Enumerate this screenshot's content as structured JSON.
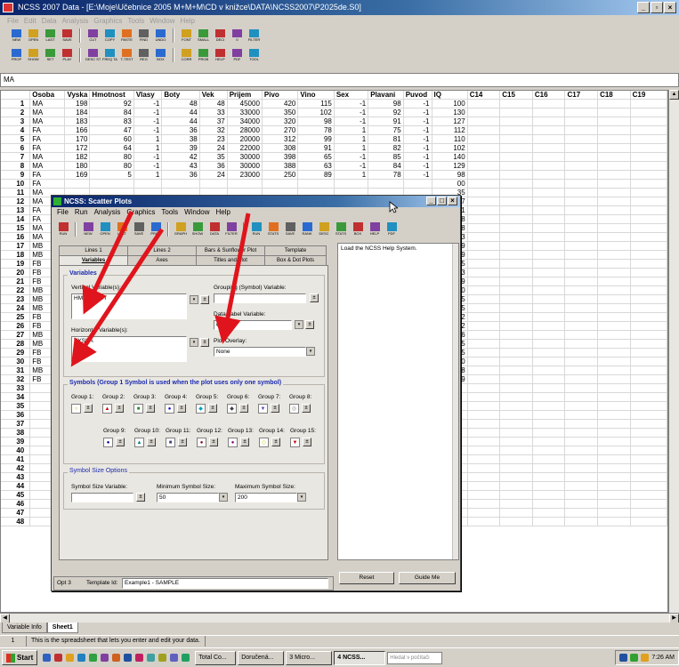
{
  "app": {
    "title": "NCSS 2007 Data - [E:\\Moje\\Učebnice 2005 M+M+M\\CD v knižce\\DATA\\NCSS2007\\P2025de.S0]",
    "menu": [
      "File",
      "Edit",
      "Data",
      "Analysis",
      "Graphics",
      "Tools",
      "Window",
      "Help"
    ],
    "toolbar1": [
      "NEW",
      "OPEN",
      "LAST",
      "SAVE",
      "CUT",
      "COPY",
      "PASTE",
      "FIND",
      "UNDO",
      "FONT",
      "SMALL",
      "DECI",
      "0",
      "FILTER"
    ],
    "toolbar2": [
      "PROP",
      "SHOW",
      "SET",
      "PLAY",
      "DESC STATS",
      "FREQ TABLE",
      "T-TEST",
      "REG",
      "BOX",
      "CORR",
      "PROB",
      "HELP",
      "PDF",
      "TOOL"
    ],
    "cell_ref": "MA"
  },
  "sheet": {
    "columns": [
      "Osoba",
      "Vyska",
      "Hmotnost",
      "Vlasy",
      "Boty",
      "Vek",
      "Prijem",
      "Pivo",
      "Vino",
      "Sex",
      "Plavani",
      "Puvod",
      "IQ",
      "C14",
      "C15",
      "C16",
      "C17",
      "C18",
      "C19"
    ],
    "rows": [
      [
        "MA",
        "198",
        "92",
        "-1",
        "48",
        "48",
        "45000",
        "420",
        "115",
        "-1",
        "98",
        "-1",
        "100"
      ],
      [
        "MA",
        "184",
        "84",
        "-1",
        "44",
        "33",
        "33000",
        "350",
        "102",
        "-1",
        "92",
        "-1",
        "130"
      ],
      [
        "MA",
        "183",
        "83",
        "-1",
        "44",
        "37",
        "34000",
        "320",
        "98",
        "-1",
        "91",
        "-1",
        "127"
      ],
      [
        "FA",
        "166",
        "47",
        "-1",
        "36",
        "32",
        "28000",
        "270",
        "78",
        "1",
        "75",
        "-1",
        "112"
      ],
      [
        "FA",
        "170",
        "60",
        "1",
        "38",
        "23",
        "20000",
        "312",
        "99",
        "1",
        "81",
        "-1",
        "110"
      ],
      [
        "FA",
        "172",
        "64",
        "1",
        "39",
        "24",
        "22000",
        "308",
        "91",
        "1",
        "82",
        "-1",
        "102"
      ],
      [
        "MA",
        "182",
        "80",
        "-1",
        "42",
        "35",
        "30000",
        "398",
        "65",
        "-1",
        "85",
        "-1",
        "140"
      ],
      [
        "MA",
        "180",
        "80",
        "-1",
        "43",
        "36",
        "30000",
        "388",
        "63",
        "-1",
        "84",
        "-1",
        "129"
      ],
      [
        "FA",
        "169",
        "5",
        "1",
        "36",
        "24",
        "23000",
        "250",
        "89",
        "1",
        "78",
        "-1",
        "98"
      ],
      [
        "FA",
        "",
        "",
        "",
        "",
        "",
        "",
        "",
        "",
        "",
        "",
        "",
        "00"
      ],
      [
        "MA",
        "",
        "",
        "",
        "",
        "",
        "",
        "",
        "",
        "",
        "",
        "",
        "35"
      ],
      [
        "MA",
        "",
        "",
        "",
        "",
        "",
        "",
        "",
        "",
        "",
        "",
        "",
        "27"
      ],
      [
        "FA",
        "",
        "",
        "",
        "",
        "",
        "",
        "",
        "",
        "",
        "",
        "",
        "01"
      ],
      [
        "FA",
        "",
        "",
        "",
        "",
        "",
        "",
        "",
        "",
        "",
        "",
        "",
        "38"
      ],
      [
        "MA",
        "",
        "",
        "",
        "",
        "",
        "",
        "",
        "",
        "",
        "",
        "",
        "28"
      ],
      [
        "MA",
        "",
        "",
        "",
        "",
        "",
        "",
        "",
        "",
        "",
        "",
        "",
        "13"
      ],
      [
        "MB",
        "",
        "",
        "",
        "",
        "",
        "",
        "",
        "",
        "",
        "",
        "",
        "39"
      ],
      [
        "MB",
        "",
        "",
        "",
        "",
        "",
        "",
        "",
        "",
        "",
        "",
        "",
        "19"
      ],
      [
        "FB",
        "",
        "",
        "",
        "",
        "",
        "",
        "",
        "",
        "",
        "",
        "",
        "95"
      ],
      [
        "FB",
        "",
        "",
        "",
        "",
        "",
        "",
        "",
        "",
        "",
        "",
        "",
        "23"
      ],
      [
        "FB",
        "",
        "",
        "",
        "",
        "",
        "",
        "",
        "",
        "",
        "",
        "",
        "19"
      ],
      [
        "MB",
        "",
        "",
        "",
        "",
        "",
        "",
        "",
        "",
        "",
        "",
        "",
        "20"
      ],
      [
        "MB",
        "",
        "",
        "",
        "",
        "",
        "",
        "",
        "",
        "",
        "",
        "",
        "15"
      ],
      [
        "MB",
        "",
        "",
        "",
        "",
        "",
        "",
        "",
        "",
        "",
        "",
        "",
        "05"
      ],
      [
        "FB",
        "",
        "",
        "",
        "",
        "",
        "",
        "",
        "",
        "",
        "",
        "",
        "32"
      ],
      [
        "FB",
        "",
        "",
        "",
        "",
        "",
        "",
        "",
        "",
        "",
        "",
        "",
        "02"
      ],
      [
        "MB",
        "",
        "",
        "",
        "",
        "",
        "",
        "",
        "",
        "",
        "",
        "",
        "36"
      ],
      [
        "MB",
        "",
        "",
        "",
        "",
        "",
        "",
        "",
        "",
        "",
        "",
        "",
        "05"
      ],
      [
        "FB",
        "",
        "",
        "",
        "",
        "",
        "",
        "",
        "",
        "",
        "",
        "",
        "25"
      ],
      [
        "FB",
        "",
        "",
        "",
        "",
        "",
        "",
        "",
        "",
        "",
        "",
        "",
        "20"
      ],
      [
        "MB",
        "",
        "",
        "",
        "",
        "",
        "",
        "",
        "",
        "",
        "",
        "",
        "18"
      ],
      [
        "FB",
        "",
        "",
        "",
        "",
        "",
        "",
        "",
        "",
        "",
        "",
        "",
        "29"
      ]
    ],
    "total_rows": 48,
    "tabs": [
      "Variable Info",
      "Sheet1"
    ],
    "status_row": "1",
    "status_text": "This is the spreadsheet that lets you enter and edit your data."
  },
  "dialog": {
    "title": "NCSS: Scatter Plots",
    "menu": [
      "File",
      "Run",
      "Analysis",
      "Graphics",
      "Tools",
      "Window",
      "Help"
    ],
    "toolbar": [
      "RUN",
      "NEW",
      "OPEN",
      "LAST",
      "SAVE",
      "PROP",
      "GRAPH",
      "SHOW",
      "DATA",
      "FILTER",
      "RUN",
      "STATS",
      "SAVE",
      "RANK",
      "DESC",
      "STATS",
      "BOX",
      "HELP",
      "PDF"
    ],
    "tabs_row1": [
      "Lines 1",
      "Lines 2",
      "Bars & Sunflower Plot",
      "Template"
    ],
    "tabs_row2": [
      "Variables",
      "Axes",
      "Titles and Plot",
      "Box & Dot Plots"
    ],
    "variables_group": "Variables",
    "vertical_label": "Vertical Variable(s):",
    "vertical_value": "HMOTNOST",
    "horizontal_label": "Horizontal Variable(s):",
    "horizontal_value": "VYSKA",
    "grouping_label": "Grouping (Symbol) Variable:",
    "grouping_value": "",
    "datalabel_label": "Data Label Variable:",
    "datalabel_value": "Osoba",
    "overlay_label": "Plot Overlay:",
    "overlay_value": "None",
    "symbols_group": "Symbols (Group 1 Symbol is used when the plot uses only one symbol)",
    "groups_row1": [
      "Group 1:",
      "Group 2:",
      "Group 3:",
      "Group 4:",
      "Group 5:",
      "Group 6:",
      "Group 7:",
      "Group 8:"
    ],
    "groups_row2": [
      "Group 9:",
      "Group 10:",
      "Group 11:",
      "Group 12:",
      "Group 13:",
      "Group 14:",
      "Group 15:"
    ],
    "symbols_row1": [
      "○",
      "▲",
      "■",
      "●",
      "◆",
      "◆",
      "▼",
      "◎"
    ],
    "symbols_row2": [
      "●",
      "▲",
      "■",
      "●",
      "●",
      "◇",
      "▼"
    ],
    "symbol_colors_row1": [
      "#c8a000",
      "#cc0000",
      "#2a8a2a",
      "#0000cc",
      "#00a0c0",
      "#404040",
      "#5040c0",
      "#808080"
    ],
    "symbol_colors_row2": [
      "#000080",
      "#008080",
      "#404080",
      "#800020",
      "#800080",
      "#c8c800",
      "#cc0000"
    ],
    "size_group": "Symbol Size Options",
    "size_var_label": "Symbol Size Variable:",
    "size_min_label": "Minimum Symbol Size:",
    "size_min_value": "50",
    "size_max_label": "Maximum Symbol Size:",
    "size_max_value": "200",
    "help_text": "Load the NCSS Help System.",
    "reset_label": "Reset",
    "guide_label": "Guide Me",
    "opt_label": "Opt 3",
    "template_label": "Template Id:",
    "template_value": "Example1 - SAMPLE"
  },
  "taskbar": {
    "start": "Start",
    "tasks": [
      "Total Co...",
      "Doručená...",
      "3 Micro...",
      "4 NCSS..."
    ],
    "search_placeholder": "Hledat v počítači",
    "time": "7:26 AM"
  },
  "annotations": {
    "arrow_color": "#e0141c"
  }
}
